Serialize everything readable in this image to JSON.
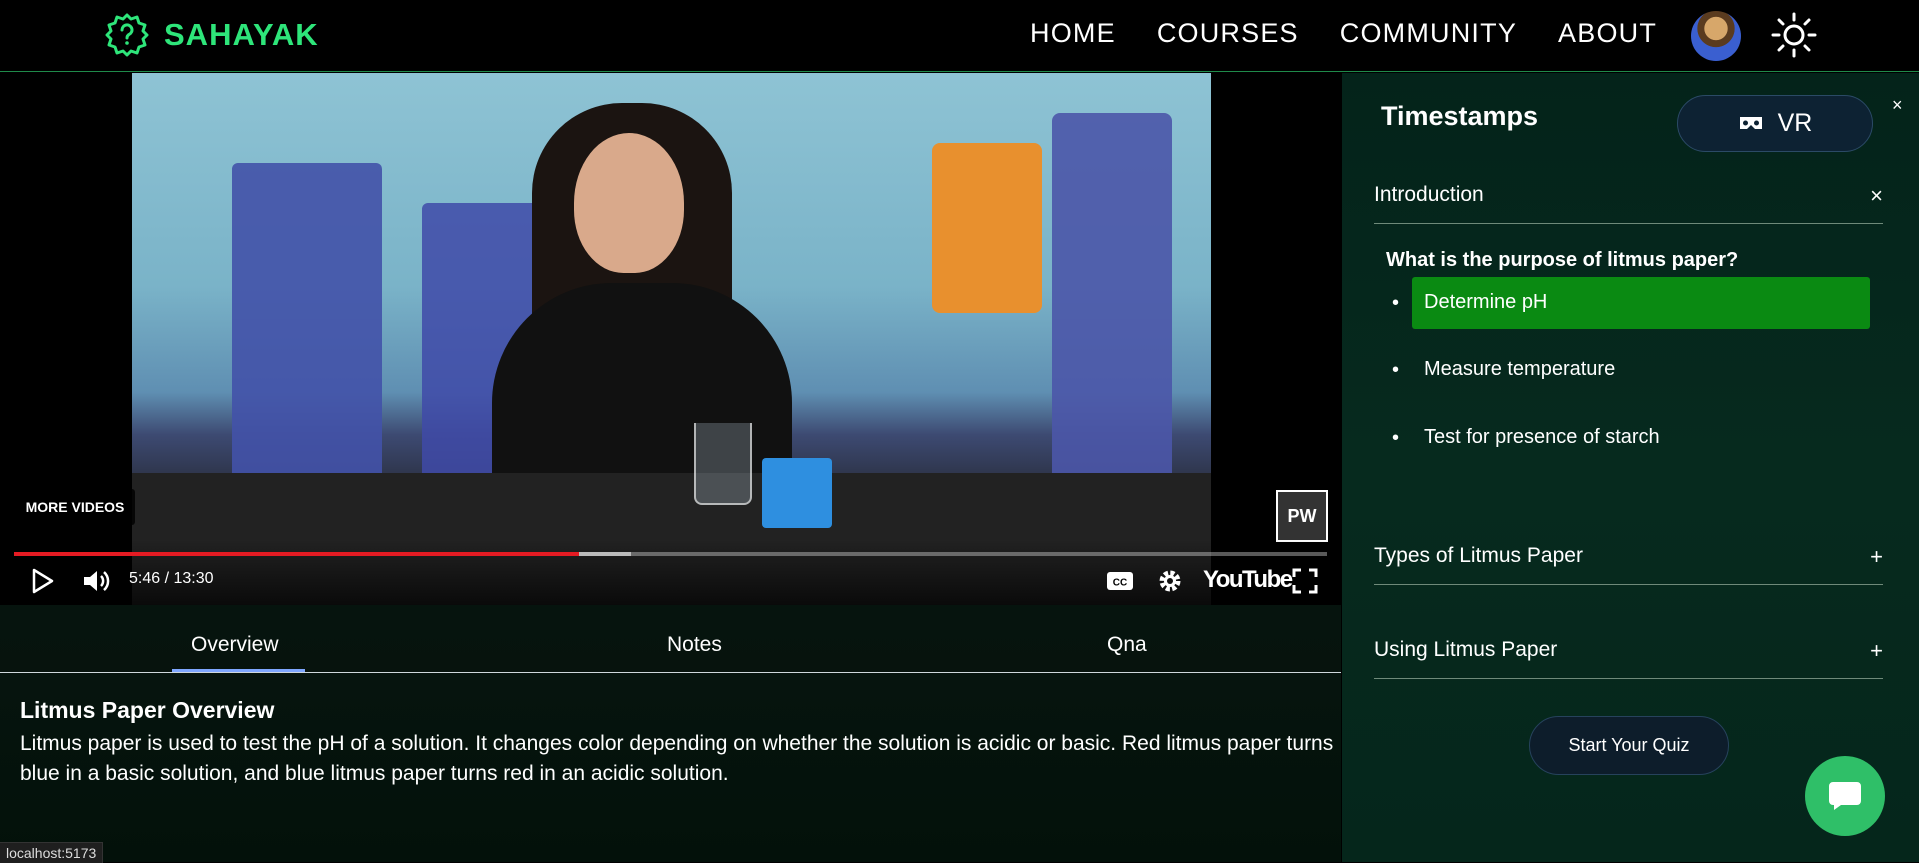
{
  "brand": {
    "name": "SAHAYAK",
    "accent": "#2ee57a"
  },
  "nav": {
    "links": [
      "HOME",
      "COURSES",
      "COMMUNITY",
      "ABOUT"
    ]
  },
  "video": {
    "more_videos": "MORE VIDEOS",
    "time": "5:46 / 13:30",
    "progress": 0.43,
    "buffered": 0.47,
    "youtube_label": "YouTube",
    "watermark": "PW"
  },
  "tabs": {
    "items": [
      "Overview",
      "Notes",
      "Qna"
    ],
    "active": "Overview"
  },
  "overview": {
    "title": "Litmus Paper Overview",
    "body": "Litmus paper is used to test the pH of a solution. It changes color depending on whether the solution is acidic or basic. Red litmus paper turns blue in a basic solution, and blue litmus paper turns red in an acidic solution."
  },
  "sidebar": {
    "title": "Timestamps",
    "vr_label": "VR",
    "close": "×",
    "sections": [
      {
        "label": "Introduction",
        "toggle": "×"
      },
      {
        "label": "Types of Litmus Paper",
        "toggle": "+"
      },
      {
        "label": "Using Litmus Paper",
        "toggle": "+"
      }
    ],
    "question": "What is the purpose of litmus paper?",
    "options": [
      {
        "label": "Determine pH",
        "selected": true
      },
      {
        "label": "Measure temperature",
        "selected": false
      },
      {
        "label": "Test for presence of starch",
        "selected": false
      }
    ],
    "quiz_button": "Start Your Quiz",
    "selected_color": "#0a8a12"
  },
  "status_url": "localhost:5173"
}
